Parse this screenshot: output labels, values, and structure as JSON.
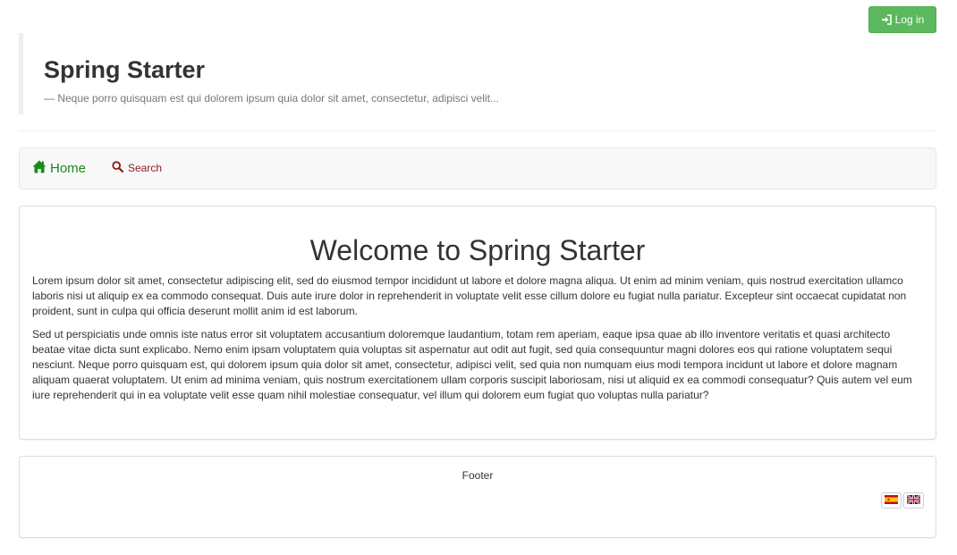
{
  "topbar": {
    "login_label": "Log in"
  },
  "header": {
    "title": "Spring Starter",
    "tagline": "— Neque porro quisquam est qui dolorem ipsum quia dolor sit amet, consectetur, adipisci velit..."
  },
  "nav": {
    "items": [
      {
        "label": "Home",
        "icon": "home-icon"
      },
      {
        "label": "Search",
        "icon": "search-icon"
      }
    ]
  },
  "main": {
    "heading": "Welcome to Spring Starter",
    "paragraphs": [
      "Lorem ipsum dolor sit amet, consectetur adipiscing elit, sed do eiusmod tempor incididunt ut labore et dolore magna aliqua. Ut enim ad minim veniam, quis nostrud exercitation ullamco laboris nisi ut aliquip ex ea commodo consequat. Duis aute irure dolor in reprehenderit in voluptate velit esse cillum dolore eu fugiat nulla pariatur. Excepteur sint occaecat cupidatat non proident, sunt in culpa qui officia deserunt mollit anim id est laborum.",
      "Sed ut perspiciatis unde omnis iste natus error sit voluptatem accusantium doloremque laudantium, totam rem aperiam, eaque ipsa quae ab illo inventore veritatis et quasi architecto beatae vitae dicta sunt explicabo. Nemo enim ipsam voluptatem quia voluptas sit aspernatur aut odit aut fugit, sed quia consequuntur magni dolores eos qui ratione voluptatem sequi nesciunt. Neque porro quisquam est, qui dolorem ipsum quia dolor sit amet, consectetur, adipisci velit, sed quia non numquam eius modi tempora incidunt ut labore et dolore magnam aliquam quaerat voluptatem. Ut enim ad minima veniam, quis nostrum exercitationem ullam corporis suscipit laboriosam, nisi ut aliquid ex ea commodi consequatur? Quis autem vel eum iure reprehenderit qui in ea voluptate velit esse quam nihil molestiae consequatur, vel illum qui dolorem eum fugiat quo voluptas nulla pariatur?"
    ]
  },
  "footer": {
    "text": "Footer",
    "languages": [
      {
        "icon": "spain-flag-icon"
      },
      {
        "icon": "uk-flag-icon"
      }
    ]
  },
  "colors": {
    "login_button": "#5cb85c",
    "nav_home": "#1a8a1a",
    "nav_search": "#8b1a1a"
  }
}
